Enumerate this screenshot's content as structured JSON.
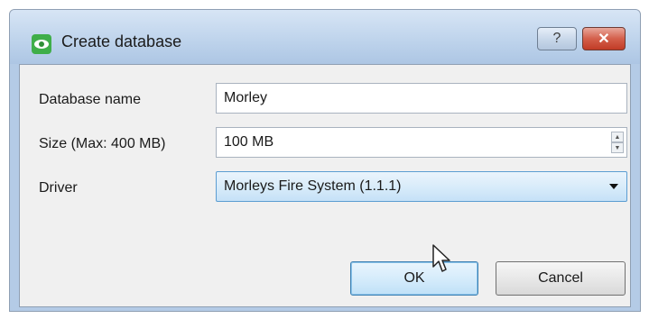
{
  "window": {
    "title": "Create database",
    "icon": "eye-app-icon",
    "help_glyph": "?",
    "close_glyph": "✕"
  },
  "form": {
    "name_label": "Database name",
    "name_value": "Morley",
    "size_label": "Size (Max: 400 MB)",
    "size_value": "100 MB",
    "driver_label": "Driver",
    "driver_value": "Morleys Fire System (1.1.1)"
  },
  "buttons": {
    "ok_label": "OK",
    "cancel_label": "Cancel"
  },
  "colors": {
    "accent": "#5c9dd2",
    "titlebar": "#bfd4ec",
    "close": "#c13b26"
  }
}
